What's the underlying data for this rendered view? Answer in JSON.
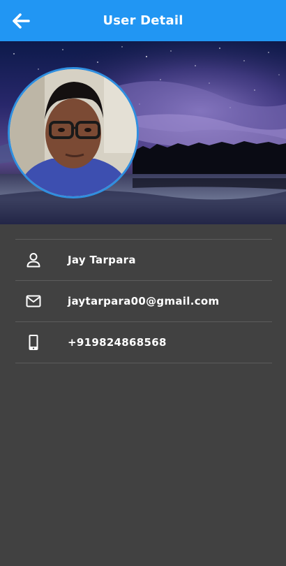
{
  "app_bar": {
    "title": "User Detail",
    "back_icon": "arrow-left-icon",
    "color": "#2196F3"
  },
  "profile": {
    "avatar_icon": "profile-photo"
  },
  "details": [
    {
      "icon": "person-icon",
      "value": "Jay Tarpara"
    },
    {
      "icon": "email-icon",
      "value": "jaytarpara00@gmail.com"
    },
    {
      "icon": "phone-icon",
      "value": "+919824868568"
    }
  ],
  "colors": {
    "background": "#414141",
    "divider": "#5c5c5c",
    "avatar_border": "#2f8fe0"
  }
}
